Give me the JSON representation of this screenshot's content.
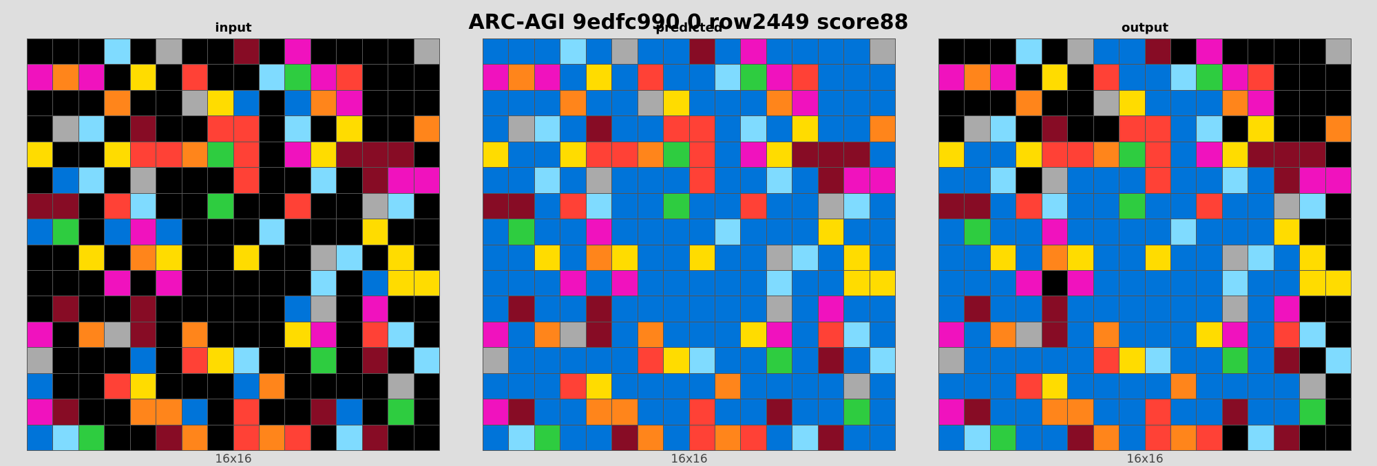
{
  "title": "ARC-AGI 9edfc990 0 row2449 score88",
  "palette": {
    "0": "#000000",
    "1": "#0074d9",
    "2": "#ff4136",
    "3": "#2ecc40",
    "4": "#ffdc00",
    "5": "#aaaaaa",
    "6": "#f012be",
    "7": "#ff851b",
    "8": "#7fdbff",
    "9": "#870c25"
  },
  "panels": [
    {
      "label": "input",
      "dims": "16x16",
      "grid": [
        [
          0,
          0,
          0,
          8,
          0,
          5,
          0,
          0,
          9,
          0,
          6,
          0,
          0,
          0,
          0,
          5
        ],
        [
          6,
          7,
          6,
          0,
          4,
          0,
          2,
          0,
          0,
          8,
          3,
          6,
          2,
          0,
          0,
          0
        ],
        [
          0,
          0,
          0,
          7,
          0,
          0,
          5,
          4,
          1,
          0,
          1,
          7,
          6,
          0,
          0,
          0
        ],
        [
          0,
          5,
          8,
          0,
          9,
          0,
          0,
          2,
          2,
          0,
          8,
          0,
          4,
          0,
          0,
          7
        ],
        [
          4,
          0,
          0,
          4,
          2,
          2,
          7,
          3,
          2,
          0,
          6,
          4,
          9,
          9,
          9,
          0
        ],
        [
          0,
          1,
          8,
          0,
          5,
          0,
          0,
          0,
          2,
          0,
          0,
          8,
          0,
          9,
          6,
          6
        ],
        [
          9,
          9,
          0,
          2,
          8,
          0,
          0,
          3,
          0,
          0,
          2,
          0,
          0,
          5,
          8,
          0
        ],
        [
          1,
          3,
          0,
          1,
          6,
          1,
          0,
          0,
          0,
          8,
          0,
          0,
          0,
          4,
          0,
          0
        ],
        [
          0,
          0,
          4,
          0,
          7,
          4,
          0,
          0,
          4,
          0,
          0,
          5,
          8,
          0,
          4,
          0
        ],
        [
          0,
          0,
          0,
          6,
          0,
          6,
          0,
          0,
          0,
          0,
          0,
          8,
          0,
          1,
          4,
          4
        ],
        [
          0,
          9,
          0,
          0,
          9,
          0,
          0,
          0,
          0,
          0,
          1,
          5,
          0,
          6,
          0,
          0
        ],
        [
          6,
          0,
          7,
          5,
          9,
          0,
          7,
          0,
          0,
          0,
          4,
          6,
          0,
          2,
          8,
          0
        ],
        [
          5,
          0,
          0,
          0,
          1,
          0,
          2,
          4,
          8,
          0,
          0,
          3,
          0,
          9,
          0,
          8
        ],
        [
          1,
          0,
          0,
          2,
          4,
          0,
          0,
          0,
          1,
          7,
          0,
          0,
          0,
          0,
          5,
          0
        ],
        [
          6,
          9,
          0,
          0,
          7,
          7,
          1,
          0,
          2,
          0,
          0,
          9,
          1,
          0,
          3,
          0
        ],
        [
          1,
          8,
          3,
          0,
          0,
          9,
          7,
          0,
          2,
          7,
          2,
          0,
          8,
          9,
          0,
          0
        ]
      ]
    },
    {
      "label": "predicted",
      "dims": "16x16",
      "grid": [
        [
          1,
          1,
          1,
          8,
          1,
          5,
          1,
          1,
          9,
          1,
          6,
          1,
          1,
          1,
          1,
          5
        ],
        [
          6,
          7,
          6,
          1,
          4,
          1,
          2,
          1,
          1,
          8,
          3,
          6,
          2,
          1,
          1,
          1
        ],
        [
          1,
          1,
          1,
          7,
          1,
          1,
          5,
          4,
          1,
          1,
          1,
          7,
          6,
          1,
          1,
          1
        ],
        [
          1,
          5,
          8,
          1,
          9,
          1,
          1,
          2,
          2,
          1,
          8,
          1,
          4,
          1,
          1,
          7
        ],
        [
          4,
          1,
          1,
          4,
          2,
          2,
          7,
          3,
          2,
          1,
          6,
          4,
          9,
          9,
          9,
          1
        ],
        [
          1,
          1,
          8,
          1,
          5,
          1,
          1,
          1,
          2,
          1,
          1,
          8,
          1,
          9,
          6,
          6
        ],
        [
          9,
          9,
          1,
          2,
          8,
          1,
          1,
          3,
          1,
          1,
          2,
          1,
          1,
          5,
          8,
          1
        ],
        [
          1,
          3,
          1,
          1,
          6,
          1,
          1,
          1,
          1,
          8,
          1,
          1,
          1,
          4,
          1,
          1
        ],
        [
          1,
          1,
          4,
          1,
          7,
          4,
          1,
          1,
          4,
          1,
          1,
          5,
          8,
          1,
          4,
          1
        ],
        [
          1,
          1,
          1,
          6,
          1,
          6,
          1,
          1,
          1,
          1,
          1,
          8,
          1,
          1,
          4,
          4
        ],
        [
          1,
          9,
          1,
          1,
          9,
          1,
          1,
          1,
          1,
          1,
          1,
          5,
          1,
          6,
          1,
          1
        ],
        [
          6,
          1,
          7,
          5,
          9,
          1,
          7,
          1,
          1,
          1,
          4,
          6,
          1,
          2,
          8,
          1
        ],
        [
          5,
          1,
          1,
          1,
          1,
          1,
          2,
          4,
          8,
          1,
          1,
          3,
          1,
          9,
          1,
          8
        ],
        [
          1,
          1,
          1,
          2,
          4,
          1,
          1,
          1,
          1,
          7,
          1,
          1,
          1,
          1,
          5,
          1
        ],
        [
          6,
          9,
          1,
          1,
          7,
          7,
          1,
          1,
          2,
          1,
          1,
          9,
          1,
          1,
          3,
          1
        ],
        [
          1,
          8,
          3,
          1,
          1,
          9,
          7,
          1,
          2,
          7,
          2,
          1,
          8,
          9,
          1,
          1
        ]
      ]
    },
    {
      "label": "output",
      "dims": "16x16",
      "grid": [
        [
          0,
          0,
          0,
          8,
          0,
          5,
          1,
          1,
          9,
          0,
          6,
          0,
          0,
          0,
          0,
          5
        ],
        [
          6,
          7,
          6,
          0,
          4,
          0,
          2,
          1,
          1,
          8,
          3,
          6,
          2,
          0,
          0,
          0
        ],
        [
          0,
          0,
          0,
          7,
          0,
          0,
          5,
          4,
          1,
          1,
          1,
          7,
          6,
          0,
          0,
          0
        ],
        [
          0,
          5,
          8,
          0,
          9,
          0,
          0,
          2,
          2,
          1,
          8,
          0,
          4,
          0,
          0,
          7
        ],
        [
          4,
          1,
          1,
          4,
          2,
          2,
          7,
          3,
          2,
          1,
          6,
          4,
          9,
          9,
          9,
          0
        ],
        [
          1,
          1,
          8,
          0,
          5,
          1,
          1,
          1,
          2,
          1,
          1,
          8,
          1,
          9,
          6,
          6
        ],
        [
          9,
          9,
          1,
          2,
          8,
          1,
          1,
          3,
          1,
          1,
          2,
          1,
          1,
          5,
          8,
          0
        ],
        [
          1,
          3,
          1,
          1,
          6,
          1,
          1,
          1,
          1,
          8,
          1,
          1,
          1,
          4,
          0,
          0
        ],
        [
          1,
          1,
          4,
          1,
          7,
          4,
          1,
          1,
          4,
          1,
          1,
          5,
          8,
          1,
          4,
          0
        ],
        [
          1,
          1,
          1,
          6,
          0,
          6,
          1,
          1,
          1,
          1,
          1,
          8,
          1,
          1,
          4,
          4
        ],
        [
          1,
          9,
          1,
          1,
          9,
          1,
          1,
          1,
          1,
          1,
          1,
          5,
          1,
          6,
          0,
          0
        ],
        [
          6,
          1,
          7,
          5,
          9,
          1,
          7,
          1,
          1,
          1,
          4,
          6,
          1,
          2,
          8,
          0
        ],
        [
          5,
          1,
          1,
          1,
          1,
          1,
          2,
          4,
          8,
          1,
          1,
          3,
          1,
          9,
          0,
          8
        ],
        [
          1,
          1,
          1,
          2,
          4,
          1,
          1,
          1,
          1,
          7,
          1,
          1,
          1,
          1,
          5,
          0
        ],
        [
          6,
          9,
          1,
          1,
          7,
          7,
          1,
          1,
          2,
          1,
          1,
          9,
          1,
          1,
          3,
          0
        ],
        [
          1,
          8,
          3,
          1,
          1,
          9,
          7,
          1,
          2,
          7,
          2,
          0,
          8,
          9,
          0,
          0
        ]
      ]
    }
  ]
}
